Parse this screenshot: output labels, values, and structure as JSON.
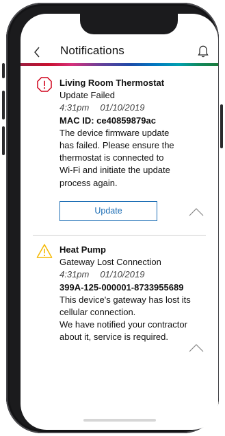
{
  "header": {
    "title": "Notifications",
    "back_icon": "chevron-left-icon",
    "bell_icon": "bell-icon"
  },
  "notifications": [
    {
      "device": "Living Room Thermostat",
      "status": "Update Failed",
      "time": "4:31pm",
      "date": "01/10/2019",
      "identifier": "MAC ID: ce40859879ac",
      "message_lines": [
        "The device firmware update",
        "has failed. Please ensure the",
        "thermostat is connected to",
        "Wi-Fi and initiate the update",
        "process again."
      ],
      "action_label": "Update",
      "icon": "error-octagon-icon",
      "icon_color": "#d0021b"
    },
    {
      "device": "Heat Pump",
      "status": "Gateway Lost Connection",
      "time": "4:31pm",
      "date": "01/10/2019",
      "identifier": "399A-125-000001-8733955689",
      "message_lines": [
        "This device's gateway has lost its",
        "cellular connection.",
        "We have notified your contractor",
        "about it, service is required."
      ],
      "icon": "warning-triangle-icon",
      "icon_color": "#f5b800"
    }
  ],
  "colors": {
    "accent": "#1a6cb4",
    "error": "#d0021b",
    "warning": "#f5b800"
  }
}
